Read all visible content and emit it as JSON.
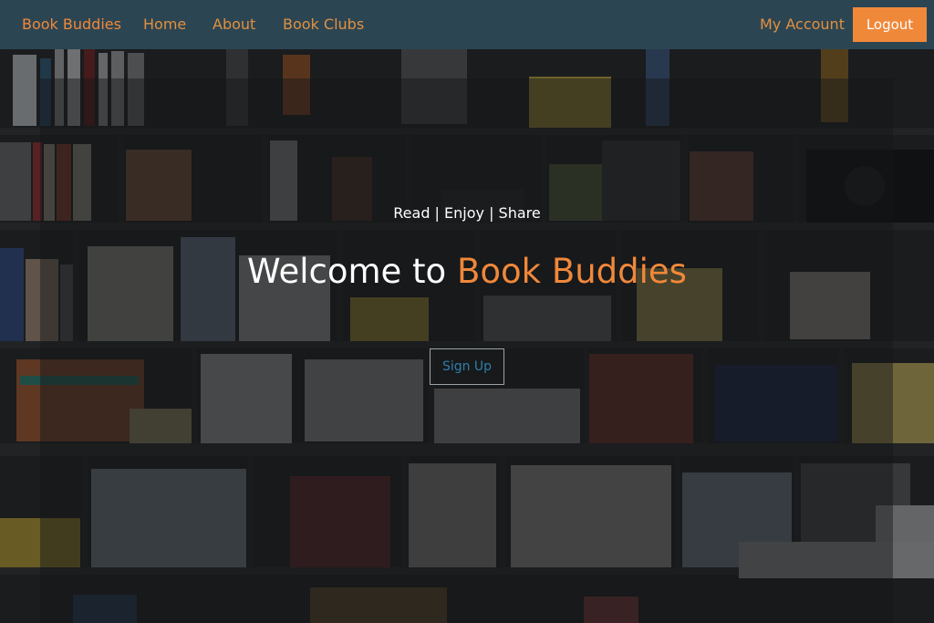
{
  "nav": {
    "brand": "Book Buddies",
    "links": [
      "Home",
      "About",
      "Book Clubs"
    ],
    "account": "My Account",
    "logout": "Logout"
  },
  "hero": {
    "tagline": "Read | Enjoy | Share",
    "headline_prefix": "Welcome to ",
    "headline_accent": "Book Buddies",
    "signup": "Sign Up"
  },
  "colors": {
    "navbar_bg": "#2c4553",
    "accent": "#f0883a",
    "signup_text": "#2f7fa8"
  }
}
